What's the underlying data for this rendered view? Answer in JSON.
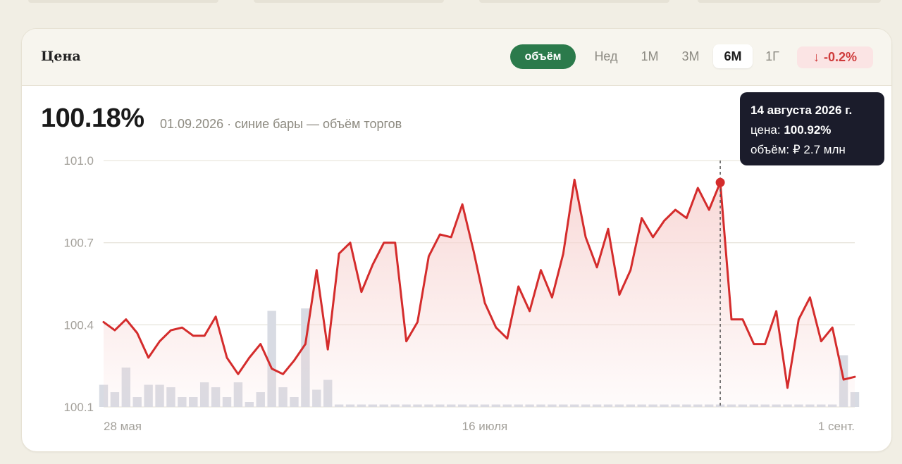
{
  "card": {
    "title": "Цена"
  },
  "controls": {
    "volume_chip": "объём",
    "ranges": [
      "Нед",
      "1М",
      "3М",
      "6М",
      "1Г"
    ],
    "active_range": "6М",
    "change": {
      "arrow": "↓",
      "value": "-0.2%"
    }
  },
  "summary": {
    "value": "100.18%",
    "date": "01.09.2026",
    "separator": "·",
    "note": "синие бары — объём торгов"
  },
  "tooltip": {
    "date": "14 августа 2026 г.",
    "price_label": "цена:",
    "price_value": "100.92%",
    "volume_label": "объём:",
    "volume_value": "₽ 2.7 млн"
  },
  "colors": {
    "line": "#d42c2c",
    "fill": "#f7d3d1",
    "volume_bar": "#d8dbe3",
    "grid": "#e9e6de",
    "accent_green": "#2b7a4b",
    "tooltip_bg": "#1b1c2b"
  },
  "chart_data": {
    "type": "line",
    "title": "Цена",
    "xlabel": "",
    "ylabel": "",
    "ylim": [
      100.1,
      101.0
    ],
    "yticks": [
      101.0,
      100.7,
      100.4,
      100.1
    ],
    "ytick_labels": [
      "101.0",
      "100.7",
      "100.4",
      "100.1"
    ],
    "x_tick_labels": [
      {
        "index": 0,
        "label": "28 мая"
      },
      {
        "index": 34,
        "label": "16 июля"
      },
      {
        "index": 67,
        "label": "1 сент."
      }
    ],
    "highlight_index": 55,
    "series": [
      {
        "values": [
          100.41,
          100.38,
          100.42,
          100.37,
          100.28,
          100.34,
          100.38,
          100.39,
          100.36,
          100.36,
          100.43,
          100.28,
          100.22,
          100.28,
          100.33,
          100.24,
          100.22,
          100.27,
          100.33,
          100.6,
          100.31,
          100.66,
          100.7,
          100.52,
          100.62,
          100.7,
          100.7,
          100.34,
          100.41,
          100.65,
          100.73,
          100.72,
          100.84,
          100.67,
          100.48,
          100.39,
          100.35,
          100.54,
          100.45,
          100.6,
          100.5,
          100.66,
          100.93,
          100.72,
          100.61,
          100.75,
          100.51,
          100.6,
          100.79,
          100.72,
          100.78,
          100.82,
          100.79,
          100.9,
          100.82,
          100.92,
          100.42,
          100.42,
          100.33,
          100.33,
          100.45,
          100.17,
          100.42,
          100.5,
          100.34,
          100.39,
          100.2,
          100.21
        ]
      },
      {
        "type": "bar",
        "values": [
          4.5,
          3.0,
          8.0,
          2.0,
          4.5,
          4.5,
          4.0,
          2.0,
          2.0,
          5.0,
          4.0,
          2.0,
          5.0,
          1.0,
          3.0,
          19.5,
          4.0,
          2.0,
          20.0,
          3.5,
          5.5,
          0.5,
          0.5,
          0.5,
          0.5,
          0.5,
          0.5,
          0.5,
          0.5,
          0.5,
          0.5,
          0.5,
          0.5,
          0.5,
          0.5,
          0.5,
          0.5,
          0.5,
          0.5,
          0.5,
          0.5,
          0.5,
          0.5,
          0.5,
          0.5,
          0.5,
          0.5,
          0.5,
          0.5,
          0.5,
          0.5,
          0.5,
          0.5,
          0.5,
          0.5,
          0.5,
          0.5,
          0.5,
          0.5,
          0.5,
          0.5,
          0.5,
          0.5,
          0.5,
          0.5,
          0.5,
          10.5,
          3.0
        ]
      }
    ]
  }
}
